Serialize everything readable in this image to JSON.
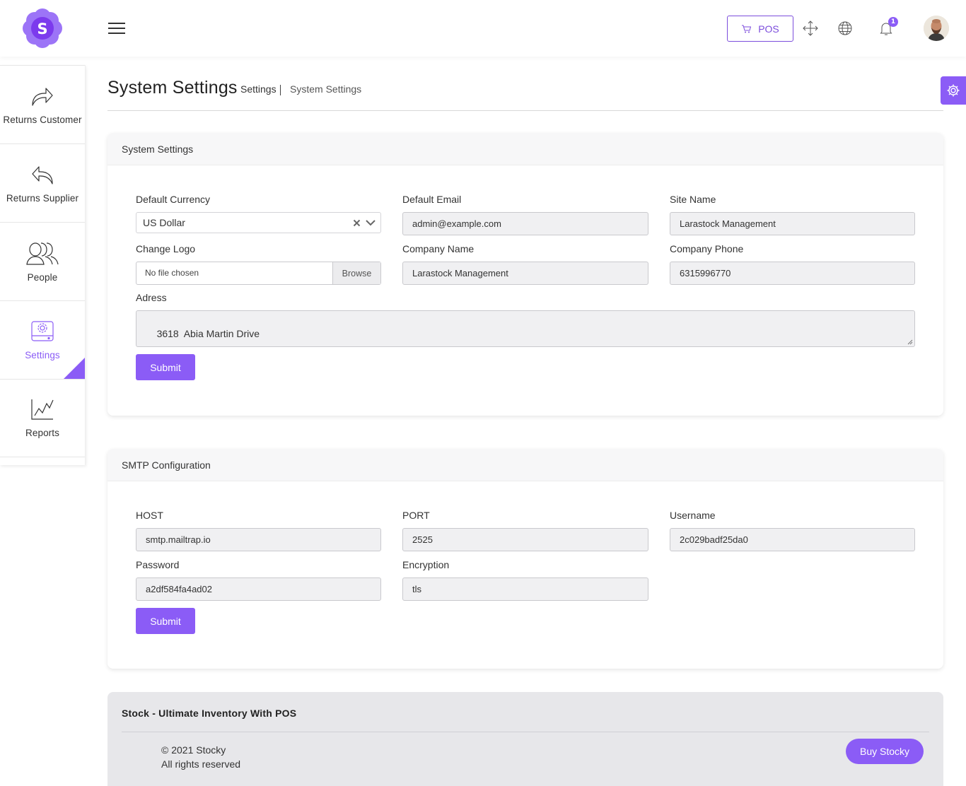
{
  "header": {
    "logo_letter": "S",
    "pos_label": "POS",
    "notification_count": "1"
  },
  "sidebar": {
    "items": [
      {
        "label": "Returns Customer",
        "icon": "share-arrow-icon"
      },
      {
        "label": "Returns Supplier",
        "icon": "reply-arrow-icon"
      },
      {
        "label": "People",
        "icon": "people-icon"
      },
      {
        "label": "Settings",
        "icon": "settings-icon",
        "active": true
      },
      {
        "label": "Reports",
        "icon": "chart-icon"
      }
    ]
  },
  "page": {
    "title": "System Settings",
    "breadcrumb_parent": "Settings",
    "breadcrumb_current": "System Settings"
  },
  "system_settings": {
    "header": "System Settings",
    "default_currency_label": "Default Currency",
    "default_currency_value": "US Dollar",
    "default_email_label": "Default Email",
    "default_email_value": "admin@example.com",
    "site_name_label": "Site Name",
    "site_name_value": "Larastock Management",
    "change_logo_label": "Change Logo",
    "file_placeholder": "No file chosen",
    "browse_label": "Browse",
    "company_name_label": "Company Name",
    "company_name_value": "Larastock Management",
    "company_phone_label": "Company Phone",
    "company_phone_value": "6315996770",
    "address_label": "Adress",
    "address_value": "3618  Abia Martin Drive",
    "submit_label": "Submit"
  },
  "smtp": {
    "header": "SMTP Configuration",
    "host_label": "HOST",
    "host_value": "smtp.mailtrap.io",
    "port_label": "PORT",
    "port_value": "2525",
    "username_label": "Username",
    "username_value": "2c029badf25da0",
    "password_label": "Password",
    "password_value": "a2df584fa4ad02",
    "encryption_label": "Encryption",
    "encryption_value": "tls",
    "submit_label": "Submit"
  },
  "footer": {
    "title": "Stock - Ultimate Inventory With POS",
    "copyright": "© 2021 Stocky",
    "rights": "All rights reserved",
    "buy_label": "Buy Stocky"
  },
  "colors": {
    "accent": "#8b5cf6",
    "logo": "#7c3aed"
  }
}
